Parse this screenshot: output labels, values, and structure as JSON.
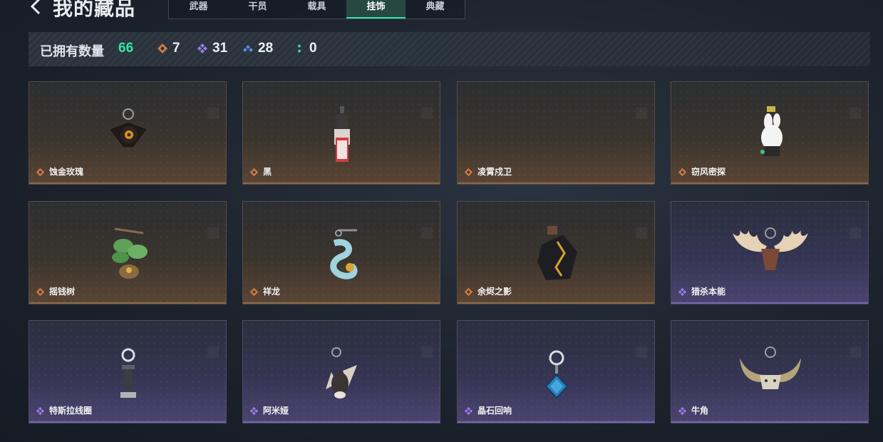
{
  "header": {
    "title": "我的藏品"
  },
  "tabs": [
    {
      "label": "武器",
      "active": false
    },
    {
      "label": "干员",
      "active": false
    },
    {
      "label": "载具",
      "active": false
    },
    {
      "label": "挂饰",
      "active": true
    },
    {
      "label": "典藏",
      "active": false
    }
  ],
  "summary": {
    "label": "已拥有数量",
    "total": "66",
    "rarities": [
      {
        "icon": "gold-rarity-icon",
        "color": "#d07a45",
        "count": "7"
      },
      {
        "icon": "purple-rarity-icon",
        "color": "#9b7be8",
        "count": "31"
      },
      {
        "icon": "blue-rarity-icon",
        "color": "#4f8ee0",
        "count": "28"
      },
      {
        "icon": "green-rarity-icon",
        "color": "#3cd69a",
        "count": "0"
      }
    ]
  },
  "items": [
    {
      "name": "蚀金玫瑰",
      "rarity": "gold",
      "art": "rose-charm-icon"
    },
    {
      "name": "黑",
      "rarity": "gold",
      "art": "black-figure-charm-icon"
    },
    {
      "name": "凌霄戍卫",
      "rarity": "gold",
      "art": "empty"
    },
    {
      "name": "窃风密探",
      "rarity": "gold",
      "art": "rabbit-charm-icon"
    },
    {
      "name": "摇钱树",
      "rarity": "gold",
      "art": "money-tree-charm-icon"
    },
    {
      "name": "祥龙",
      "rarity": "gold",
      "art": "dragon-charm-icon"
    },
    {
      "name": "余烬之影",
      "rarity": "gold",
      "art": "ember-shadow-charm-icon"
    },
    {
      "name": "猎杀本能",
      "rarity": "purple",
      "art": "moose-antler-charm-icon"
    },
    {
      "name": "特斯拉线圈",
      "rarity": "purple",
      "art": "tesla-coil-charm-icon"
    },
    {
      "name": "阿米娅",
      "rarity": "purple",
      "art": "amiya-charm-icon"
    },
    {
      "name": "晶石回响",
      "rarity": "purple",
      "art": "crystal-charm-icon"
    },
    {
      "name": "牛角",
      "rarity": "purple",
      "art": "bull-horn-charm-icon"
    }
  ],
  "colors": {
    "accent": "#2fe3a4",
    "gold": "#d07a45",
    "purple": "#9b7be8"
  }
}
